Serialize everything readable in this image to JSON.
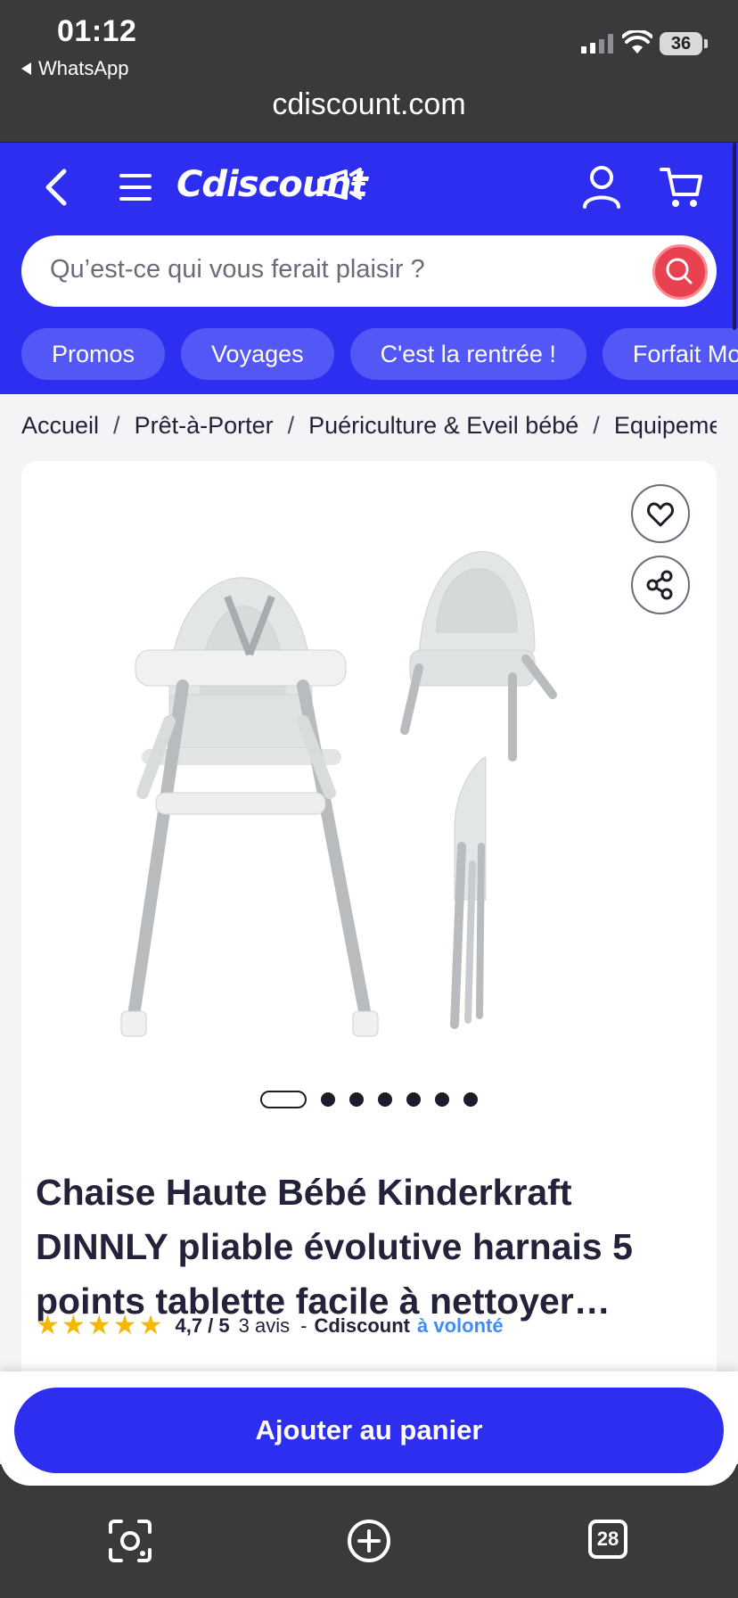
{
  "status_bar": {
    "time": "01:12",
    "back_app": "WhatsApp",
    "battery": "36"
  },
  "browser": {
    "url": "cdiscount.com",
    "tabs_count": "28"
  },
  "header": {
    "logo": "Cdiscount",
    "search_placeholder": "Qu’est-ce qui vous ferait plaisir ?",
    "chips": [
      "Promos",
      "Voyages",
      "C'est la rentrée !",
      "Forfait Mobile"
    ]
  },
  "breadcrumb": [
    "Accueil",
    "Prêt-à-Porter",
    "Puériculture & Eveil bébé",
    "Equipement"
  ],
  "product": {
    "title": "Chaise Haute Bébé Kinderkraft DINNLY pliable évolutive harnais 5 points tablette facile à nettoyer…",
    "rating_value": "4,7 / 5",
    "rating_fraction": 0.94,
    "reviews": "3 avis",
    "separator": "-",
    "seller": "Cdiscount",
    "seller_suffix": "à volonté",
    "carousel_total": 7,
    "carousel_active": 1
  },
  "cta": {
    "label": "Ajouter au panier"
  },
  "colors": {
    "brand": "#2d2ef0",
    "search_btn": "#e8414f",
    "chip": "#5257f6",
    "star": "#f5b800",
    "link": "#3d8cff"
  }
}
